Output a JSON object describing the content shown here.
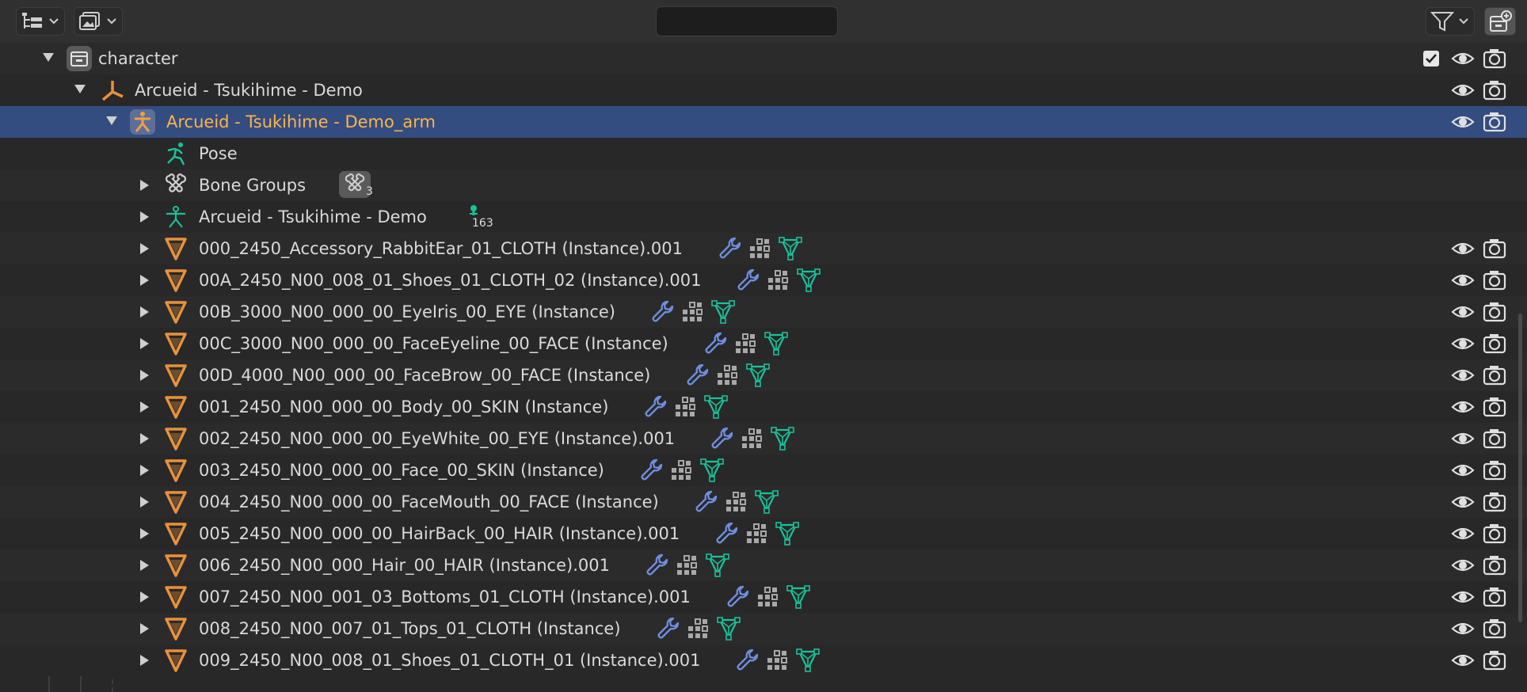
{
  "header": {
    "search_placeholder": "",
    "display_mode_icon": "outliner-display-icon",
    "filter_icon": "funnel-icon",
    "new_collection_icon": "new-collection-icon"
  },
  "tree": {
    "collection": {
      "label": "character"
    },
    "armature_object": {
      "label": "Arcueid - Tsukihime - Demo"
    },
    "selected_object": {
      "label": "Arcueid - Tsukihime - Demo_arm"
    },
    "pose": {
      "label": "Pose"
    },
    "bone_groups": {
      "label": "Bone Groups",
      "count": "3"
    },
    "armature_data": {
      "label": "Arcueid - Tsukihime - Demo",
      "bone_count": "163"
    },
    "meshes": [
      {
        "label": "000_2450_Accessory_RabbitEar_01_CLOTH (Instance).001"
      },
      {
        "label": "00A_2450_N00_008_01_Shoes_01_CLOTH_02 (Instance).001"
      },
      {
        "label": "00B_3000_N00_000_00_EyeIris_00_EYE (Instance)"
      },
      {
        "label": "00C_3000_N00_000_00_FaceEyeline_00_FACE (Instance)"
      },
      {
        "label": "00D_4000_N00_000_00_FaceBrow_00_FACE (Instance)"
      },
      {
        "label": "001_2450_N00_000_00_Body_00_SKIN (Instance)"
      },
      {
        "label": "002_2450_N00_000_00_EyeWhite_00_EYE (Instance).001"
      },
      {
        "label": "003_2450_N00_000_00_Face_00_SKIN (Instance)"
      },
      {
        "label": "004_2450_N00_000_00_FaceMouth_00_FACE (Instance)"
      },
      {
        "label": "005_2450_N00_000_00_HairBack_00_HAIR (Instance).001"
      },
      {
        "label": "006_2450_N00_000_Hair_00_HAIR (Instance).001"
      },
      {
        "label": "007_2450_N00_001_03_Bottoms_01_CLOTH (Instance).001"
      },
      {
        "label": "008_2450_N00_007_01_Tops_01_CLOTH (Instance)"
      },
      {
        "label": "009_2450_N00_008_01_Shoes_01_CLOTH_01 (Instance).001"
      }
    ]
  },
  "colors": {
    "selected_row": "#334d80",
    "selected_text": "#ffb347",
    "armature_orange": "#e8913a",
    "mesh_orange": "#e8913a",
    "data_green": "#19c29a",
    "modifier_blue": "#6e8fe0"
  }
}
